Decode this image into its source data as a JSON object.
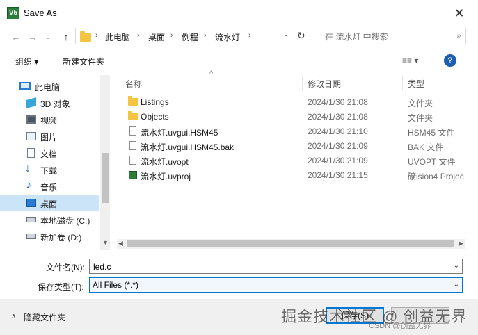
{
  "window": {
    "title": "Save As",
    "app_icon": "V5",
    "close_glyph": "✕"
  },
  "nav": {
    "back": "←",
    "forward": "→",
    "dropdown": "⌄",
    "up": "↑",
    "breadcrumbs": [
      "此电脑",
      "桌面",
      "例程",
      "流水灯"
    ],
    "addr_dropdown": "⌄",
    "refresh": "↻",
    "search_placeholder": "在 流水灯 中搜索"
  },
  "toolbar": {
    "organize": "组织 ▾",
    "new_folder": "新建文件夹",
    "view": "≡≡ ▾",
    "help": "?"
  },
  "sidebar": {
    "items": [
      {
        "label": "此电脑",
        "icon": "pc-icon",
        "selected": false
      },
      {
        "label": "3D 对象",
        "icon": "3d-objects-icon",
        "selected": false
      },
      {
        "label": "视频",
        "icon": "video-icon",
        "selected": false
      },
      {
        "label": "图片",
        "icon": "pictures-icon",
        "selected": false
      },
      {
        "label": "文档",
        "icon": "documents-icon",
        "selected": false
      },
      {
        "label": "下载",
        "icon": "download-icon",
        "selected": false
      },
      {
        "label": "音乐",
        "icon": "music-icon",
        "selected": false
      },
      {
        "label": "桌面",
        "icon": "desktop-icon",
        "selected": true
      },
      {
        "label": "本地磁盘 (C:)",
        "icon": "drive-icon",
        "selected": false
      },
      {
        "label": "新加卷 (D:)",
        "icon": "drive-icon",
        "selected": false
      }
    ]
  },
  "filelist": {
    "columns": {
      "name": "名称",
      "date": "修改日期",
      "type": "类型"
    },
    "sort_glyph": "^",
    "rows": [
      {
        "name": "Listings",
        "date": "2024/1/30 21:08",
        "type": "文件夹",
        "icon": "folder"
      },
      {
        "name": "Objects",
        "date": "2024/1/30 21:08",
        "type": "文件夹",
        "icon": "folder"
      },
      {
        "name": "流水灯.uvgui.HSM45",
        "date": "2024/1/30 21:10",
        "type": "HSM45 文件",
        "icon": "file"
      },
      {
        "name": "流水灯.uvgui.HSM45.bak",
        "date": "2024/1/30 21:09",
        "type": "BAK 文件",
        "icon": "file"
      },
      {
        "name": "流水灯.uvopt",
        "date": "2024/1/30 21:09",
        "type": "UVOPT 文件",
        "icon": "file"
      },
      {
        "name": "流水灯.uvproj",
        "date": "2024/1/30 21:15",
        "type": "礦ision4 Projec",
        "icon": "project"
      }
    ]
  },
  "form": {
    "filename_label": "文件名(N):",
    "filename_value": "led.c",
    "type_label": "保存类型(T):",
    "type_value": "All Files (*.*)"
  },
  "footer": {
    "hide_folders": "隐藏文件夹",
    "save": "保存(S)",
    "watermark": "掘金技术社区 @ 创益无界",
    "watermark_small": "CSDN @创益无界"
  }
}
